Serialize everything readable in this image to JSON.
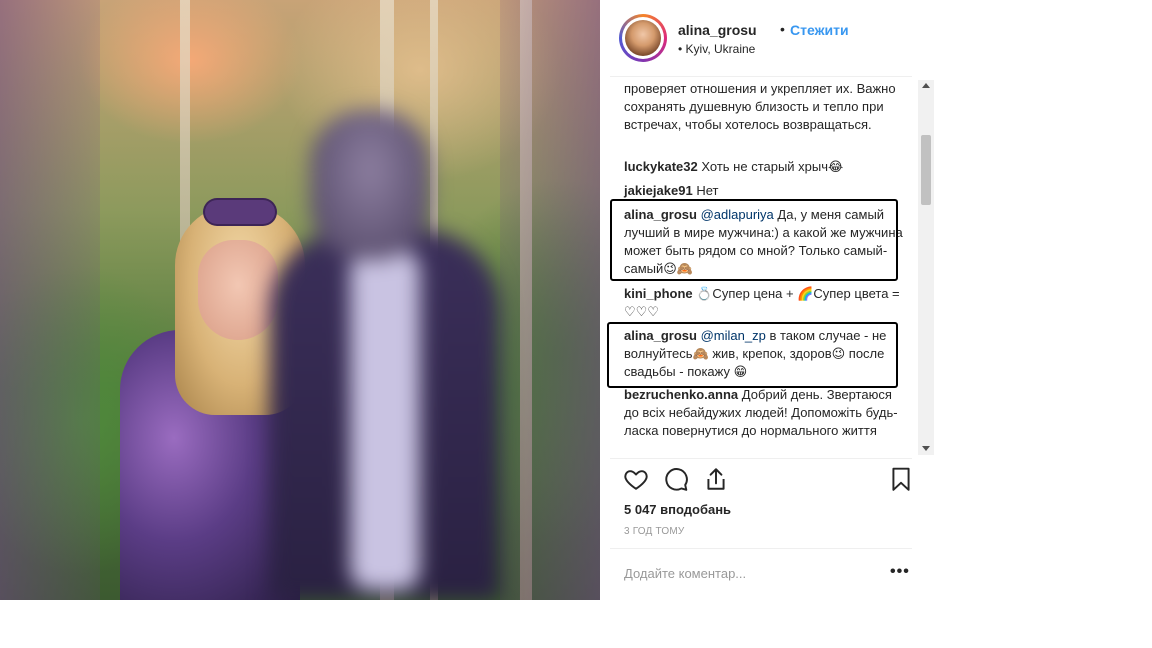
{
  "post": {
    "username": "alina_grosu",
    "separator": "•",
    "follow_label": "Стежити",
    "location_prefix": "•",
    "location": "Kyiv, Ukraine"
  },
  "comments": [
    {
      "username": "",
      "text": "проверяет отношения и укрепляет их. Важно сохранять душевную близость и тепло при встречах, чтобы хотелось возвращаться."
    },
    {
      "username": "luckykate32",
      "text": "Хоть не старый хрыч😂"
    },
    {
      "username": "jakiejake91",
      "text": "Нет"
    },
    {
      "username": "alina_grosu",
      "mention": "@adlapuriya",
      "text": "Да, у меня самый лучший в мире мужчина:) а какой же мужчина может быть рядом со мной? Только самый-самый😉🙈",
      "highlighted": true
    },
    {
      "username": "kini_phone",
      "text": "💍Супер цена + 🌈Супер цвета = ♡♡♡"
    },
    {
      "username": "alina_grosu",
      "mention": "@milan_zp",
      "text": "в таком случае - не волнуйтесь🙈 жив, крепок, здоров😉 после свадьбы - покажу 😁",
      "highlighted": true
    },
    {
      "username": "bezruchenko.anna",
      "text": "Добрий день. Звертаюся до всіх небайдужих людей! Допоможіть будь-ласка повернутися до нормального життя"
    }
  ],
  "actions": {
    "like_icon": "heart-icon",
    "comment_icon": "comment-icon",
    "share_icon": "share-icon",
    "save_icon": "bookmark-icon"
  },
  "likes": "5 047 вподобань",
  "timestamp": "3 ГОД ТОМУ",
  "add_comment_placeholder": "Додайте коментар...",
  "more_label": "•••"
}
